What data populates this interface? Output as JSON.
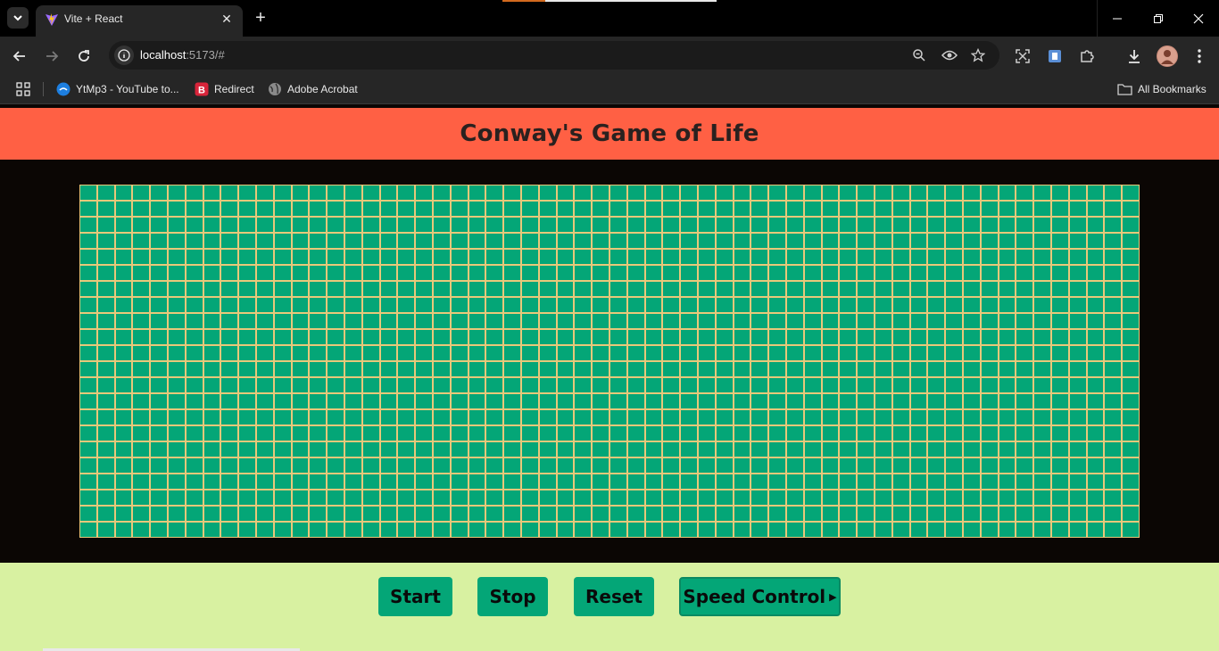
{
  "browser": {
    "tab": {
      "title": "Vite + React"
    },
    "url": {
      "host": "localhost",
      "path": ":5173/#"
    },
    "bookmarks": [
      {
        "label": "YtMp3 - YouTube to..."
      },
      {
        "label": "Redirect"
      },
      {
        "label": "Adobe Acrobat"
      }
    ],
    "all_bookmarks_label": "All Bookmarks"
  },
  "app": {
    "title": "Conway's Game of Life",
    "grid": {
      "rows": 22,
      "cols": 60,
      "cell_color": "#04a677",
      "line_color": "#e8c87a",
      "alive_cells": []
    },
    "controls": {
      "start_label": "Start",
      "stop_label": "Stop",
      "reset_label": "Reset",
      "speed_label": "Speed Control"
    }
  },
  "colors": {
    "header_bg": "#ff6044",
    "controls_bg": "#d8f1a1",
    "button_bg": "#04a677",
    "page_bg": "#0b0604"
  }
}
